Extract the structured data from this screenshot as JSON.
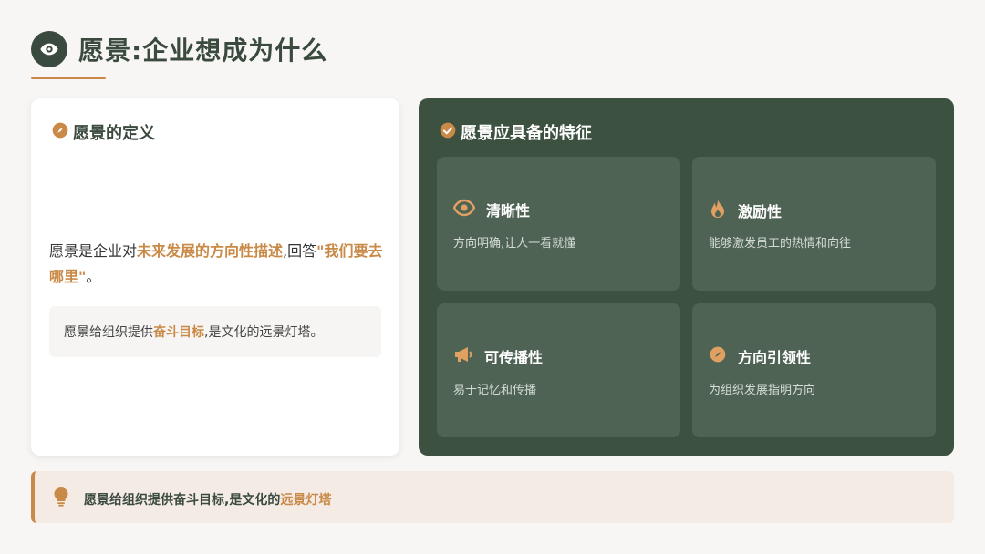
{
  "header": {
    "title": "愿景:企业想成为什么",
    "icon": "eye-icon"
  },
  "definition": {
    "heading": "愿景的定义",
    "heading_icon": "compass-icon",
    "text_prefix": "愿景是企业对",
    "text_highlight1": "未来发展的方向性描述",
    "text_middle": ",回答",
    "text_highlight2": "\"我们要去哪里\"",
    "text_suffix": "。",
    "note_prefix": "愿景给组织提供",
    "note_highlight": "奋斗目标",
    "note_suffix": ",是文化的远景灯塔。"
  },
  "features": {
    "heading": "愿景应具备的特征",
    "heading_icon": "check-circle-icon",
    "items": [
      {
        "title": "清晰性",
        "desc": "方向明确,让人一看就懂",
        "icon": "eye-icon"
      },
      {
        "title": "激励性",
        "desc": "能够激发员工的热情和向往",
        "icon": "flame-icon"
      },
      {
        "title": "可传播性",
        "desc": "易于记忆和传播",
        "icon": "megaphone-icon"
      },
      {
        "title": "方向引领性",
        "desc": "为组织发展指明方向",
        "icon": "compass-icon"
      }
    ]
  },
  "banner": {
    "text_prefix": "愿景给组织提供奋斗目标,是文化的",
    "text_highlight": "远景灯塔",
    "icon": "lightbulb-icon"
  },
  "colors": {
    "primary_dark_green": "#3a4a3e",
    "card_green": "#3d5141",
    "tile_green": "#4f6354",
    "accent_orange": "#c98a48",
    "banner_bg": "#f4ebe5",
    "page_bg": "#f8f6f4"
  }
}
